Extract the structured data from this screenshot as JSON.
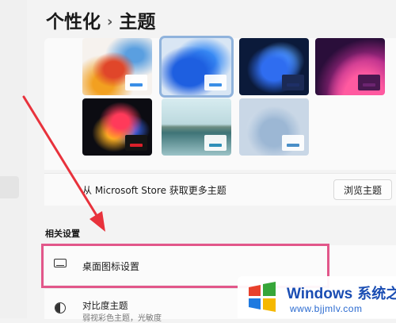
{
  "breadcrumb": {
    "parent": "个性化",
    "separator": "›",
    "current": "主题"
  },
  "themes": {
    "items": [
      {
        "name": "theme-thumbnail-1",
        "selected": false,
        "taskbar_color": "#3a8ee6"
      },
      {
        "name": "theme-thumbnail-2",
        "selected": true,
        "taskbar_color": "#3a8ee6"
      },
      {
        "name": "theme-thumbnail-3",
        "selected": false,
        "taskbar_color": "#1e2f66"
      },
      {
        "name": "theme-thumbnail-4",
        "selected": false,
        "taskbar_color": "#6b2470"
      },
      {
        "name": "theme-thumbnail-5",
        "selected": false,
        "taskbar_color": "#d9202a"
      },
      {
        "name": "theme-thumbnail-6",
        "selected": false,
        "taskbar_color": "#2f8fb8"
      },
      {
        "name": "theme-thumbnail-7",
        "selected": false,
        "taskbar_color": "#4a8fc8"
      }
    ]
  },
  "store": {
    "text": "从 Microsoft Store 获取更多主题",
    "button": "浏览主题"
  },
  "related": {
    "heading": "相关设置",
    "desktop_icons": "桌面图标设置",
    "contrast_title": "对比度主题",
    "contrast_sub": "弱视彩色主题，光敏度"
  },
  "watermark": {
    "brand": "Windows",
    "brand_cn": "系统之家",
    "url": "www.bjjmlv.com"
  },
  "colors": {
    "highlight": "#e2578a",
    "arrow": "#e8323c",
    "selection": "#90b3dc"
  }
}
